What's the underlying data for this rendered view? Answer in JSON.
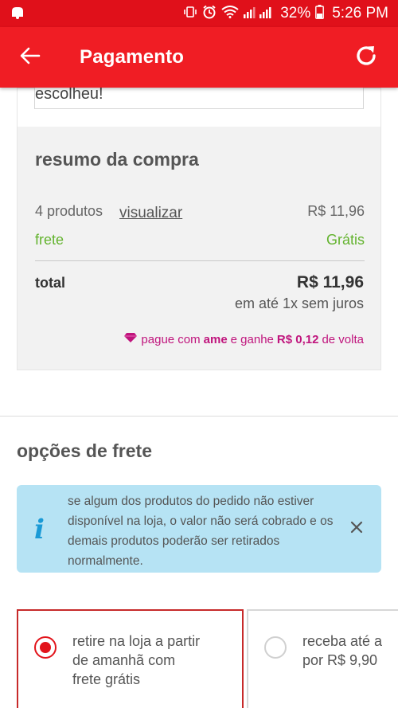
{
  "status_bar": {
    "battery": "32%",
    "time": "5:26 PM",
    "icons": [
      "app-notification-icon",
      "vibrate-icon",
      "alarm-icon",
      "wifi-icon",
      "signal-icon",
      "battery-icon"
    ]
  },
  "app_bar": {
    "title": "Pagamento",
    "back_icon": "arrow-left-icon",
    "refresh_icon": "refresh-icon"
  },
  "top_input": {
    "text": "escolheu!"
  },
  "summary": {
    "title": "resumo da compra",
    "products_count": "4 produtos",
    "view_link": "visualizar",
    "products_value": "R$ 11,96",
    "freight_label": "frete",
    "freight_value": "Grátis",
    "total_label": "total",
    "total_value": "R$ 11,96",
    "installments": "em até 1x sem juros",
    "ame_pre": "pague com",
    "ame_brand": "ame",
    "ame_mid": "e ganhe",
    "ame_value": "R$ 0,12",
    "ame_post": "de volta"
  },
  "freight_options": {
    "title": "opções de frete",
    "info": "se algum dos produtos do pedido não estiver disponível na loja, o valor não será cobrado e os demais produtos poderão ser retirados normalmente.",
    "info_icon": "i",
    "options": [
      {
        "label": "retire na loja a partir\nde amanhã com\nfrete grátis",
        "selected": true
      },
      {
        "label": "receba até a\npor R$ 9,90",
        "selected": false
      }
    ]
  },
  "colors": {
    "brand_red": "#f01d24",
    "status_red": "#e0101a",
    "green": "#63b32e",
    "ame_pink": "#c0157d",
    "info_blue": "#b6e3f4"
  }
}
